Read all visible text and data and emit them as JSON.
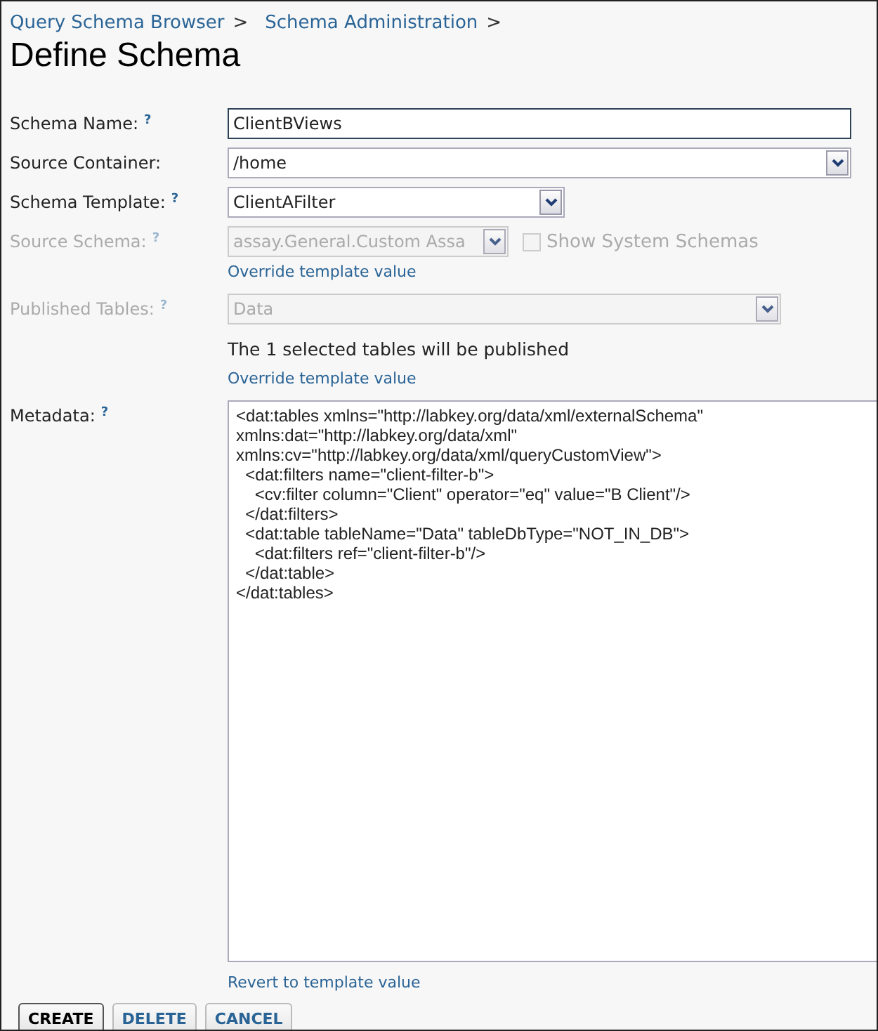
{
  "breadcrumbs": [
    {
      "label": "Query Schema Browser",
      "separator": ">"
    },
    {
      "label": "Schema Administration",
      "separator": ">"
    }
  ],
  "title": "Define Schema",
  "fields": [
    {
      "label": "Schema Name:",
      "help": "?",
      "kind": "text",
      "value": "ClientBViews",
      "disabled": false
    },
    {
      "label": "Source Container:",
      "kind": "select",
      "value": "/home",
      "disabled": false
    },
    {
      "label": "Schema Template:",
      "help": "?",
      "kind": "select",
      "value": "ClientAFilter",
      "disabled": false
    },
    {
      "label": "Source Schema:",
      "help": "?",
      "kind": "select",
      "value": "assay.General.Custom Assa",
      "disabled": true,
      "checkbox": {
        "label": "Show System Schemas",
        "checked": false,
        "disabled": true
      },
      "link": "Override template value"
    },
    {
      "label": "Published Tables:",
      "help": "?",
      "kind": "select",
      "value": "Data",
      "disabled": true,
      "note": "The 1 selected tables will be published",
      "link": "Override template value"
    },
    {
      "label": "Metadata:",
      "help": "?",
      "kind": "textarea",
      "value": "<dat:tables xmlns=\"http://labkey.org/data/xml/externalSchema\"\nxmlns:dat=\"http://labkey.org/data/xml\"\nxmlns:cv=\"http://labkey.org/data/xml/queryCustomView\">\n  <dat:filters name=\"client-filter-b\">\n    <cv:filter column=\"Client\" operator=\"eq\" value=\"B Client\"/>\n  </dat:filters>\n  <dat:table tableName=\"Data\" tableDbType=\"NOT_IN_DB\">\n    <dat:filters ref=\"client-filter-b\"/>\n  </dat:table>\n</dat:tables>",
      "disabled": false,
      "link": "Revert to template value"
    }
  ],
  "buttons": [
    {
      "label": "CREATE",
      "primary": true
    },
    {
      "label": "DELETE",
      "primary": false
    },
    {
      "label": "CANCEL",
      "primary": false
    }
  ]
}
